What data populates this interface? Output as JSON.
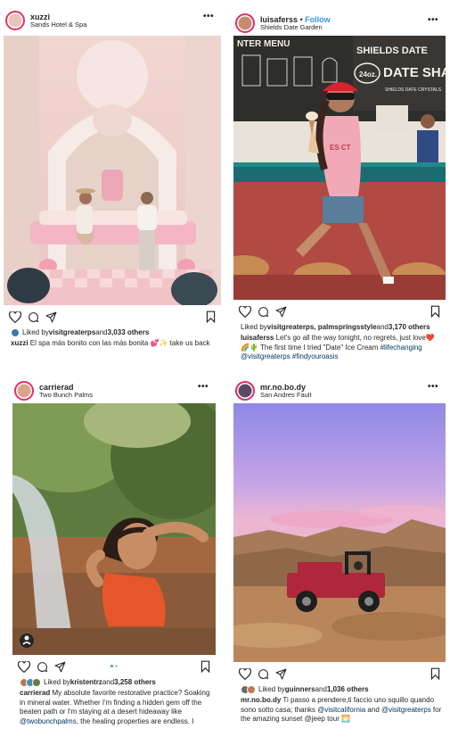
{
  "posts": [
    {
      "username": "xuzzi",
      "location": "Sands Hotel & Spa",
      "more_label": "•••",
      "likes": {
        "prefix": "Liked by ",
        "user": "visitgreaterps",
        "mid": " and ",
        "count": "3,033 others"
      },
      "caption": {
        "user": "xuzzi",
        "text": " El spa más bonito con las más bonita 💕✨ take us back"
      },
      "avatar_color": "#e7c4b7"
    },
    {
      "username": "luisaferss",
      "separator": " • ",
      "follow_label": "Follow",
      "location": "Shields Date Garden",
      "more_label": "•••",
      "likes": {
        "prefix": "Liked by ",
        "user": "visitgreaterps, palmspringsstyle",
        "mid": " and ",
        "count": "3,170 others"
      },
      "caption": {
        "user": "luisaferss",
        "text": " Let's go all the way tonight, no regrets, just love❤️🌈🌵 The first time I tried \"Date\" Ice Cream ",
        "hashtags": "#lifechanging @visitgreaterps #findyouroasis"
      },
      "avatar_color": "#c98a6e"
    },
    {
      "username": "carrierad",
      "location": "Two Bunch Palms",
      "more_label": "•••",
      "likes": {
        "prefix": "Liked by ",
        "user": "kristentrz",
        "mid": " and ",
        "count": "3,258 others"
      },
      "caption": {
        "user": "carrierad",
        "text": " My absolute favorite restorative practice? Soaking in mineral water. Whether I'm finding a hidden gem off the beaten path or I'm staying at a desert hideaway like ",
        "mention": "@twobunchpalms",
        "text2": ", the healing properties are endless. I"
      },
      "avatar_color": "#d8a58a"
    },
    {
      "username": "mr.no.bo.dy",
      "location": "San Andres Fault",
      "more_label": "•••",
      "likes": {
        "prefix": "Liked by ",
        "user": "guinners",
        "mid": " and ",
        "count": "1,036 others"
      },
      "caption": {
        "user": "mr.no.bo.dy",
        "text": " Ti passo a prendere,ti faccio uno squillo quando sono sotto casa; thanks ",
        "mention": "@visitcalifornia",
        "text2": " and ",
        "mention2": "@visitgreaterps",
        "text3": " for the amazing sunset @jeep tour 🌅"
      },
      "avatar_color": "#5a4a66"
    }
  ],
  "photo_signs": {
    "menu": "NTER MENU",
    "shields": "SHIELDS DATE",
    "date_shake": "DATE SHA",
    "oz": "24oz.",
    "dates_sub": "SHIELDS DATE CRYSTALS",
    "tee": "ES\nCT"
  },
  "colors": {
    "link": "#003569",
    "follow": "#3897f0",
    "story_ring": "#e1306c"
  }
}
